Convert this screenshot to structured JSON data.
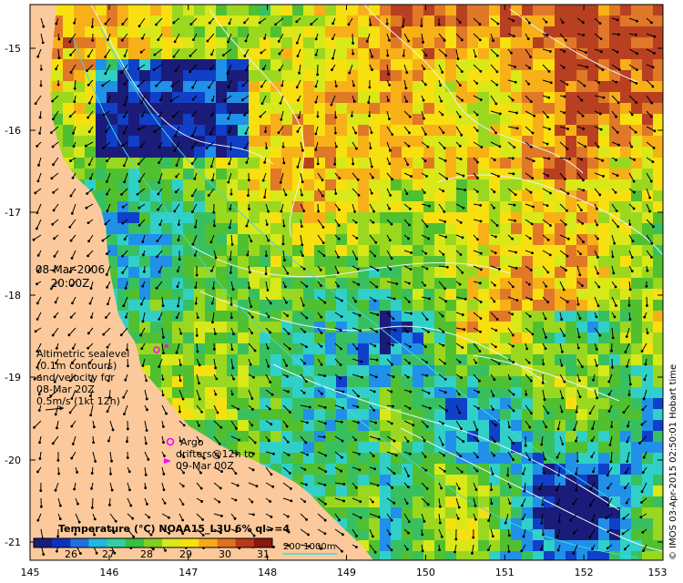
{
  "map": {
    "axis_x_ticks": [
      "145",
      "146",
      "147",
      "148",
      "149",
      "150",
      "151",
      "152",
      "153"
    ],
    "axis_y_ticks": [
      "-15",
      "-16",
      "-17",
      "-18",
      "-19",
      "-20",
      "-21"
    ],
    "date_lines": [
      "08-Mar-2006",
      "20:00Z"
    ],
    "altimetry_lines": [
      "Altimetric sealevel",
      "(0.1m contours)",
      "and velocity for",
      "08-Mar 20Z",
      "0.5m/s (1kt 12h)"
    ],
    "argo_label": "Argo",
    "drifter_lines": [
      "drifters@12h to",
      "09-Mar 00Z"
    ],
    "colorbar_title": "Temperature (°C) NOAA15_L3U 6% ql>=4",
    "colorbar_ticks": [
      "26",
      "27",
      "28",
      "29",
      "30",
      "31"
    ],
    "depth_legend": "200  1000m",
    "credit": "© IMOS 03-Apr-2015 02:50:01 Hobart time"
  },
  "colors": {
    "land": "#fbc99b",
    "contour": "#e8f4ff",
    "isobath": "#40d8d8",
    "argo": "#ff00ff",
    "arrow": "#000000"
  },
  "colorbar_colors": [
    "#1b1b7a",
    "#1030c0",
    "#1f6fe0",
    "#20b8e0",
    "#30d0a0",
    "#38c040",
    "#80d020",
    "#d8e818",
    "#f8e010",
    "#f8a818",
    "#e07020",
    "#b83818",
    "#8a1810"
  ]
}
